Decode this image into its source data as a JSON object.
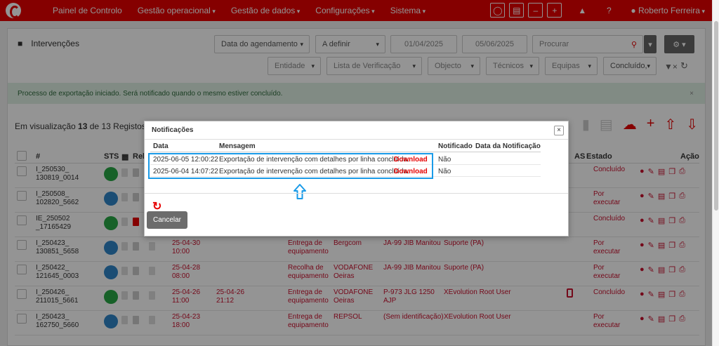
{
  "nav": {
    "items": [
      "Painel de Controlo",
      "Gestão operacional",
      "Gestão de dados",
      "Configurações",
      "Sistema"
    ],
    "user": "Roberto Ferreira"
  },
  "page": {
    "title": "Intervenções",
    "filters": {
      "date_field": "Data do agendamento",
      "period": "A definir",
      "date_from": "01/04/2025",
      "date_to": "05/06/2025",
      "search_placeholder": "Procurar",
      "entity": "Entidade",
      "checklist": "Lista de Verificação",
      "object": "Objecto",
      "technicians": "Técnicos",
      "teams": "Equipas",
      "status": "Concluído,"
    },
    "alert": "Processo de exportação iniciado. Será notificado quando o mesmo estiver concluído.",
    "summary": {
      "prefix": "Em visualização",
      "shown": "13",
      "of": "de",
      "total": "13",
      "suffix": "Registos"
    }
  },
  "table": {
    "headers": {
      "num": "#",
      "sts": "STS",
      "rel": "Rel",
      "as": "AS",
      "estado": "Estado",
      "acao": "Ação"
    },
    "rows": [
      {
        "num1": "I_250530_",
        "num2": "130819_0014",
        "dot": "#28a745",
        "estado1": "Concluído",
        "estado2": "",
        "redfile": false
      },
      {
        "num1": "I_250508_",
        "num2": "102820_5662",
        "dot": "#2f86c8",
        "estado1": "Por",
        "estado2": "executar",
        "redfile": false
      },
      {
        "num1": "IE_250502",
        "num2": "_17165429",
        "dot": "#28a745",
        "estado1": "Concluído",
        "estado2": "",
        "redfile": true
      },
      {
        "num1": "I_250423_",
        "num2": "130851_5658",
        "dot": "#2f86c8",
        "d1a": "25-04-30",
        "d1b": "10:00",
        "tipo1": "Entrega de",
        "tipo2": "equipamento",
        "ent1": "Bergcom",
        "ent2": "",
        "obj1": "JA-99 JIB Manitou",
        "obj2": "",
        "tec": "Suporte (PA)",
        "estado1": "Por",
        "estado2": "executar",
        "redfile": false
      },
      {
        "num1": "I_250422_",
        "num2": "121645_0003",
        "dot": "#2f86c8",
        "d1a": "25-04-28",
        "d1b": "08:00",
        "tipo1": "Recolha de",
        "tipo2": "equipamento",
        "ent1": "VODAFONE",
        "ent2": "Oeiras",
        "obj1": "JA-99 JIB Manitou",
        "obj2": "",
        "tec": "Suporte (PA)",
        "estado1": "Por",
        "estado2": "executar",
        "redfile": false
      },
      {
        "num1": "I_250426_",
        "num2": "211015_5661",
        "dot": "#28a745",
        "d1a": "25-04-26",
        "d1b": "11:00",
        "d2a": "25-04-26",
        "d2b": "21:12",
        "tipo1": "Entrega de",
        "tipo2": "equipamento",
        "ent1": "VODAFONE",
        "ent2": "Oeiras",
        "obj1": "P-973 JLG 1250",
        "obj2": "AJP",
        "tec": "XEvolution Root User",
        "estado1": "Concluído",
        "estado2": "",
        "phone": true,
        "redfile": false
      },
      {
        "num1": "I_250423_",
        "num2": "162750_5660",
        "dot": "#2f86c8",
        "d1a": "25-04-23",
        "d1b": "18:00",
        "tipo1": "Entrega de",
        "tipo2": "equipamento",
        "ent1": "REPSOL",
        "ent2": "",
        "obj1": "(Sem identificação)",
        "obj2": "",
        "tec": "XEvolution Root User",
        "estado1": "Por",
        "estado2": "executar",
        "redfile": false
      }
    ]
  },
  "modal": {
    "title": "Notificações",
    "close": "×",
    "headers": {
      "data": "Data",
      "mensagem": "Mensagem",
      "notificado": "Notificado",
      "data_notif": "Data da Notificação"
    },
    "rows": [
      {
        "data": "2025-06-05 12:00:22",
        "mensagem": "Exportação de intervenção com detalhes por linha concluída.",
        "link": "Download",
        "notificado": "Não"
      },
      {
        "data": "2025-06-04 14:07:22",
        "mensagem": "Exportação de intervenção com detalhes por linha concluída.",
        "link": "Download",
        "notificado": "Não"
      }
    ],
    "cancel": "Cancelar"
  }
}
